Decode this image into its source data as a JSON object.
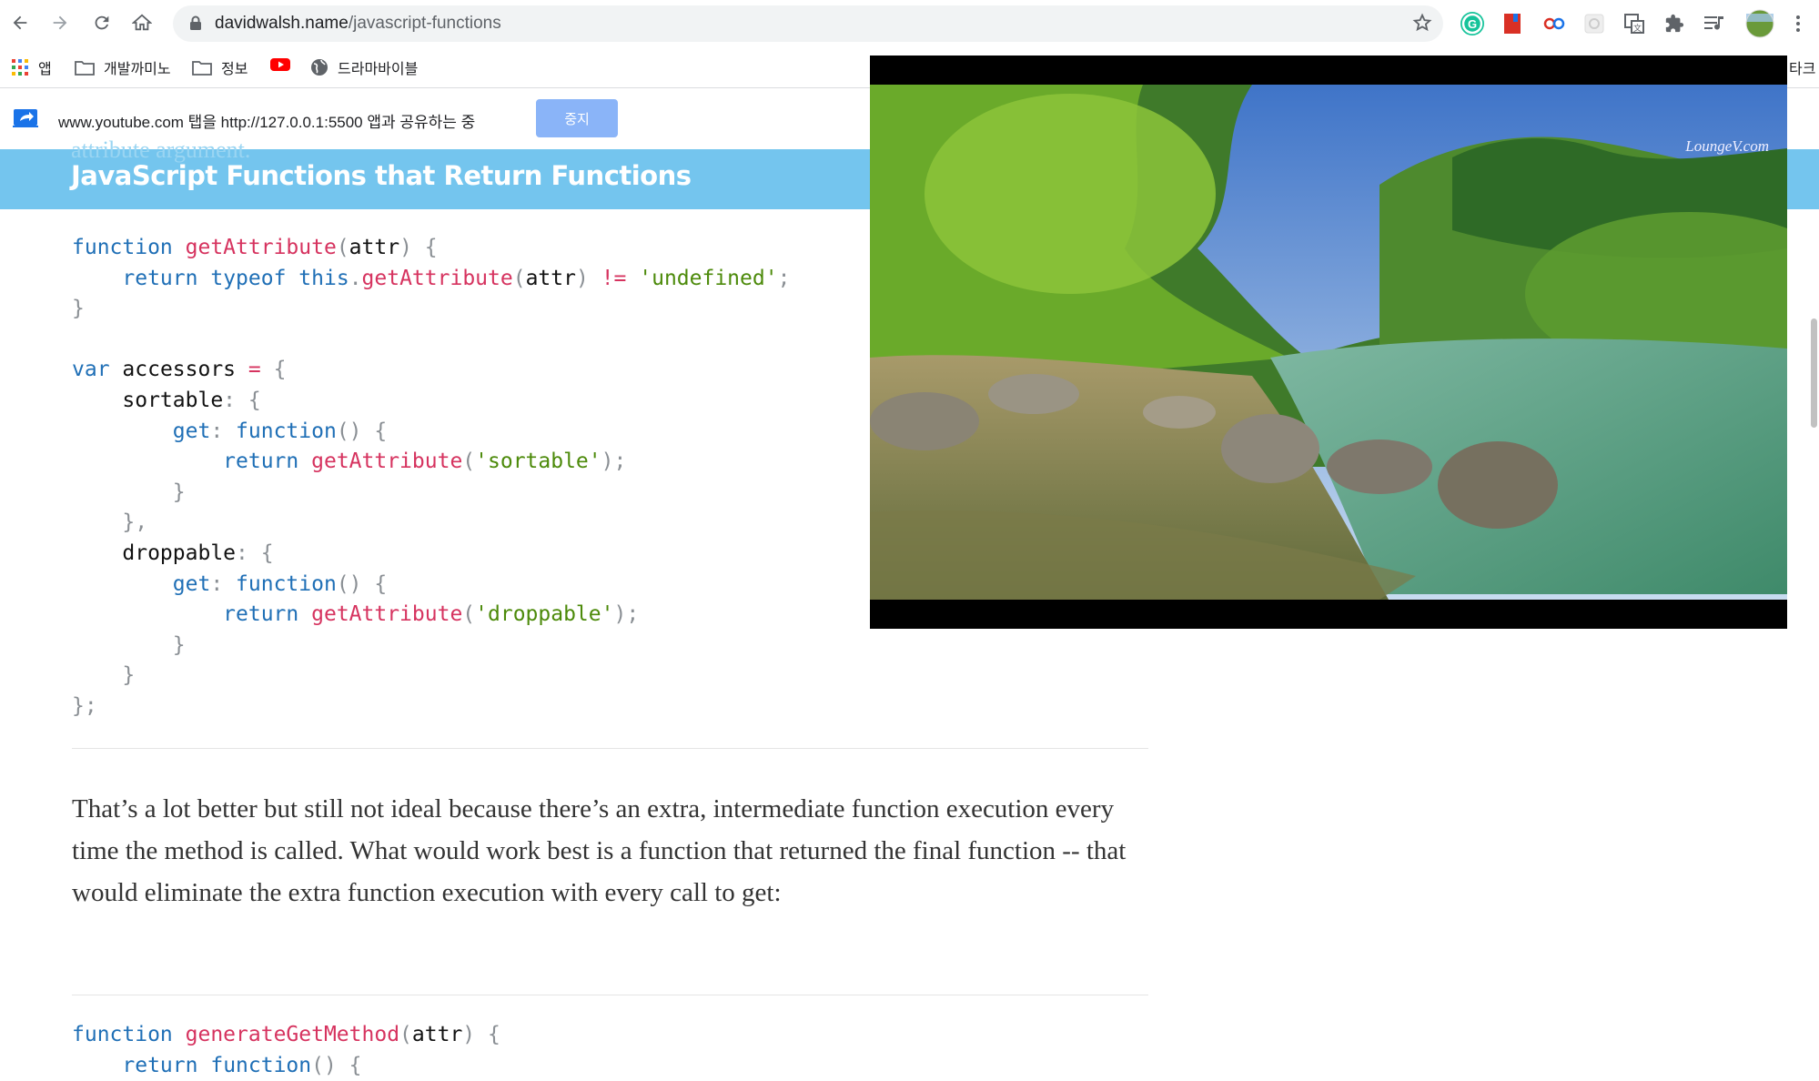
{
  "browser": {
    "url_host": "davidwalsh.name",
    "url_path": "/javascript-functions",
    "bookmarks": [
      {
        "label": "앱",
        "icon": "apps-grid-icon"
      },
      {
        "label": "개발까미노",
        "icon": "folder-icon"
      },
      {
        "label": "정보",
        "icon": "folder-icon"
      },
      {
        "label": "",
        "icon": "youtube-icon"
      },
      {
        "label": "드라마바이블",
        "icon": "globe-icon"
      }
    ],
    "bookmarks_overflow": "타크"
  },
  "share_bar": {
    "message": "www.youtube.com 탭을 http://127.0.0.1:5500 앱과 공유하는 중",
    "stop_label": "중지"
  },
  "article": {
    "partial_text_above": "attribute argument.",
    "heading": "JavaScript Functions that Return Functions",
    "paragraph": "That’s a lot better but still not ideal because there’s an extra, intermediate function execution every time the method is called.  What would work best is a function that returned the final function  -- that would eliminate the extra function execution with every call to get:"
  },
  "video": {
    "watermark": "LoungeV.com"
  }
}
